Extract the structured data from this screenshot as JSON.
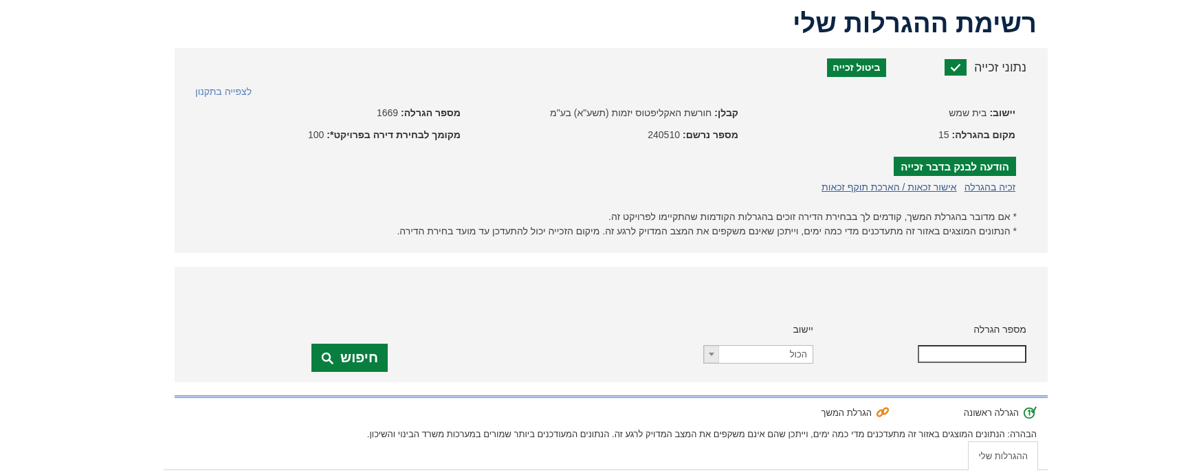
{
  "page": {
    "title": "רשימת ההגרלות שלי"
  },
  "win_panel": {
    "heading": "נתוני זכייה",
    "win_checked": true,
    "cancel_button": "ביטול זכייה",
    "regulations_link": "לצפייה בתקנון",
    "fields": [
      {
        "label": "יישוב:",
        "value": "בית שמש"
      },
      {
        "label": "קבלן:",
        "value": "חורשת האקליפטוס יזמות (תשע\"א) בע\"מ"
      },
      {
        "label": "מספר הגרלה:",
        "value": "1669"
      },
      {
        "label": "מקום בהגרלה:",
        "value": "15"
      },
      {
        "label": "מספר נרשם:",
        "value": "240510"
      },
      {
        "label": "מקומך לבחירת דירה בפרויקט*:",
        "value": "100"
      }
    ],
    "bank_button": "הודעה לבנק בדבר זכייה",
    "links": [
      "זכיה בהגרלה",
      "אישור זכאות / הארכת תוקף זכאות"
    ],
    "notes": [
      "* אם מדובר בהגרלת המשך, קודמים לך בבחירת הדירה זוכים בהגרלות הקודמות שהתקיימו לפרויקט זה.",
      "* הנתונים המוצגים באזור זה מתעדכנים מדי כמה ימים, וייתכן שאינם משקפים את המצב המדויק לרגע זה. מיקום הזכייה יכול להתעדכן עד מועד בחירת הדירה."
    ]
  },
  "search": {
    "fields": [
      {
        "kind": "text",
        "label": "מספר הגרלה"
      },
      {
        "kind": "select",
        "label": "יישוב",
        "value": "הכול"
      }
    ],
    "button": "חיפוש"
  },
  "legend": [
    {
      "kind": "first",
      "label": "הגרלה ראשונה"
    },
    {
      "kind": "continuation",
      "label": "הגרלת המשך"
    }
  ],
  "disclaimer": "הבהרה: הנתונים המוצגים באזור זה מתעדכנים מדי כמה ימים, וייתכן שהם אינם משקפים את המצב המדויק לרגע זה. הנתונים המעודכנים ביותר שמורים במערכות משרד הבינוי והשיכון.",
  "tabs": [
    {
      "label": "ההגרלות שלי",
      "selected": true
    }
  ]
}
